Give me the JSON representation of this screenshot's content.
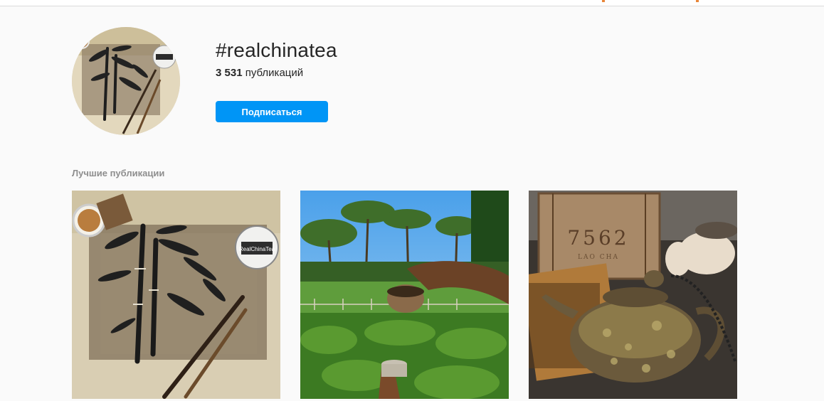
{
  "hashtag": {
    "title": "#realchinatea",
    "post_count": "3 531",
    "post_count_label": "публикаций",
    "follow_label": "Подписаться"
  },
  "top_posts": {
    "heading": "Лучшие публикации",
    "items": [
      {
        "icon": "bamboo-painting-image",
        "jar_label": "RealChinaTea"
      },
      {
        "icon": "park-tea-pour-image"
      },
      {
        "icon": "teapot-image",
        "brick_label": "7562",
        "brick_sublabel": "LAO CHA"
      }
    ]
  }
}
